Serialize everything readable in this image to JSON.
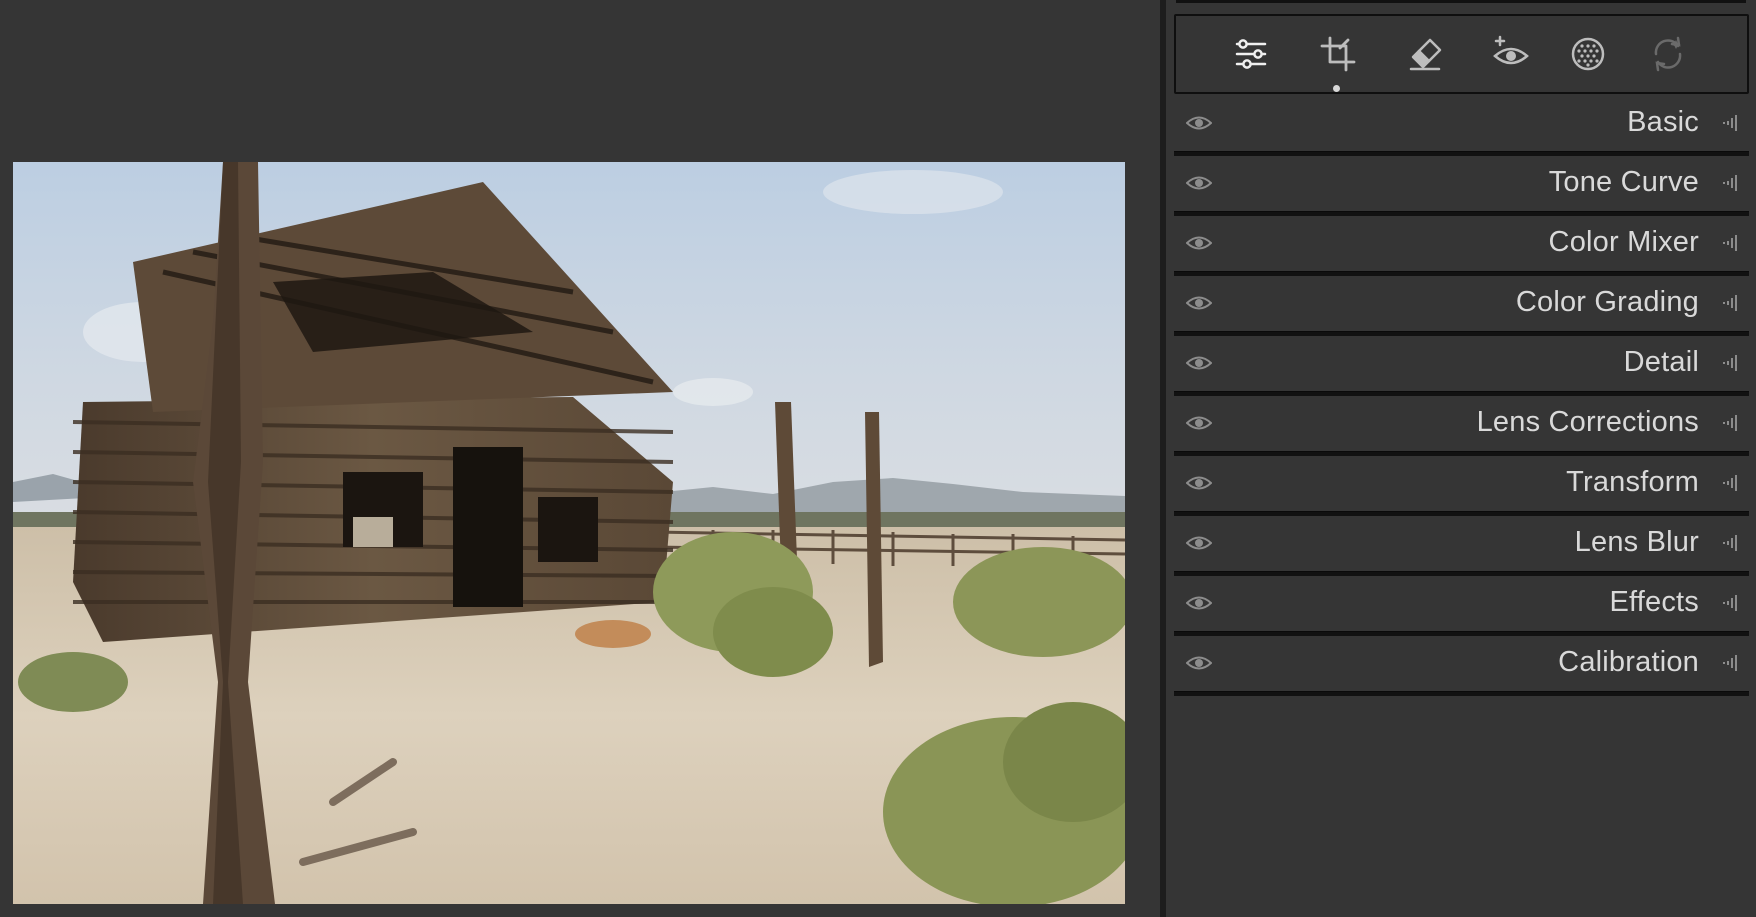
{
  "photo": {
    "subject": "",
    "accent_sky": "#c9d6e4",
    "accent_ground": "#d8cbb6"
  },
  "toolbar": {
    "tools": [
      {
        "icon": "edit-sliders-icon"
      },
      {
        "icon": "crop-icon"
      },
      {
        "icon": "eraser-icon"
      },
      {
        "icon": "red-eye-icon"
      },
      {
        "icon": "masking-icon"
      },
      {
        "icon": "presets-icon"
      }
    ],
    "active_index": 1
  },
  "sections": [
    {
      "label": "Basic"
    },
    {
      "label": "Tone Curve"
    },
    {
      "label": "Color Mixer"
    },
    {
      "label": "Color Grading"
    },
    {
      "label": "Detail"
    },
    {
      "label": "Lens Corrections"
    },
    {
      "label": "Transform"
    },
    {
      "label": "Lens Blur"
    },
    {
      "label": "Effects"
    },
    {
      "label": "Calibration"
    }
  ],
  "colors": {
    "background": "#353535",
    "separator": "#111111",
    "text": "#d9d9d9",
    "icon": "#bdbdbd"
  }
}
